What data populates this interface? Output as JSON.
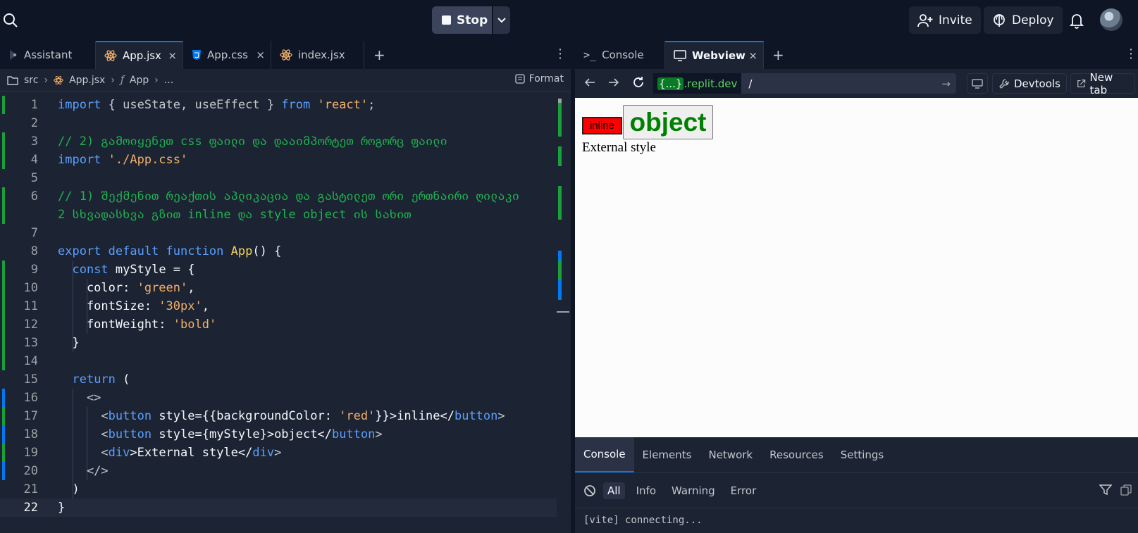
{
  "topbar": {
    "stop_label": "Stop",
    "invite_label": "Invite",
    "deploy_label": "Deploy"
  },
  "editor": {
    "tabs": [
      {
        "label": "Assistant",
        "icon": "assistant-icon"
      },
      {
        "label": "App.jsx",
        "icon": "react-icon",
        "active": true
      },
      {
        "label": "App.css",
        "icon": "css-icon"
      },
      {
        "label": "index.jsx",
        "icon": "react-icon"
      }
    ],
    "close_glyph": "×",
    "plus_glyph": "+",
    "more_glyph": "⋮",
    "breadcrumb": [
      "src",
      "App.jsx",
      "App",
      "..."
    ],
    "format_label": "Format",
    "line_numbers": [
      "1",
      "2",
      "3",
      "4",
      "5",
      "6",
      "",
      "7",
      "8",
      "9",
      "10",
      "11",
      "12",
      "13",
      "14",
      "15",
      "16",
      "17",
      "18",
      "19",
      "20",
      "21",
      "22"
    ],
    "lines": [
      [
        {
          "t": "import",
          "c": "kw"
        },
        {
          "t": " { useState, useEffect } ",
          "c": "pu"
        },
        {
          "t": "from",
          "c": "kw"
        },
        {
          "t": " 'react'",
          "c": "str"
        },
        {
          "t": ";",
          "c": "pu"
        }
      ],
      [],
      [
        {
          "t": "// 2) გამოიყენეთ css ფაილი და დააიმპორტეთ როგორც ფაილი",
          "c": "cm"
        }
      ],
      [
        {
          "t": "import",
          "c": "kw"
        },
        {
          "t": " './App.css'",
          "c": "str"
        }
      ],
      [],
      [
        {
          "t": "// 1) შექმენით რეაქთის აპლიკაცია და გასტილეთ ორი ერთნაირი ღილაკი",
          "c": "cm"
        }
      ],
      [
        {
          "t": "2 სხვადასხვა გზით inline და style object ის სახით",
          "c": "cm"
        }
      ],
      [],
      [
        {
          "t": "export default function",
          "c": "kw"
        },
        {
          "t": " ",
          "c": "pl"
        },
        {
          "t": "App",
          "c": "fn"
        },
        {
          "t": "() {",
          "c": "pl"
        }
      ],
      [
        {
          "t": "  ",
          "c": "pl"
        },
        {
          "t": "const",
          "c": "kw"
        },
        {
          "t": " myStyle = {",
          "c": "pl"
        }
      ],
      [
        {
          "t": "    color: ",
          "c": "pl"
        },
        {
          "t": "'green'",
          "c": "str"
        },
        {
          "t": ",",
          "c": "pl"
        }
      ],
      [
        {
          "t": "    fontSize: ",
          "c": "pl"
        },
        {
          "t": "'30px'",
          "c": "str"
        },
        {
          "t": ",",
          "c": "pl"
        }
      ],
      [
        {
          "t": "    fontWeight: ",
          "c": "pl"
        },
        {
          "t": "'bold'",
          "c": "str"
        }
      ],
      [
        {
          "t": "  }",
          "c": "pl"
        }
      ],
      [],
      [
        {
          "t": "  ",
          "c": "pl"
        },
        {
          "t": "return",
          "c": "kw"
        },
        {
          "t": " (",
          "c": "pl"
        }
      ],
      [
        {
          "t": "    <>",
          "c": "pu"
        }
      ],
      [
        {
          "t": "      <",
          "c": "pu"
        },
        {
          "t": "button",
          "c": "tag"
        },
        {
          "t": " style={{backgroundColor: ",
          "c": "pl"
        },
        {
          "t": "'red'",
          "c": "str"
        },
        {
          "t": "}}>inline</",
          "c": "pl"
        },
        {
          "t": "button",
          "c": "tag"
        },
        {
          "t": ">",
          "c": "pu"
        }
      ],
      [
        {
          "t": "      <",
          "c": "pu"
        },
        {
          "t": "button",
          "c": "tag"
        },
        {
          "t": " style={myStyle}>object</",
          "c": "pl"
        },
        {
          "t": "button",
          "c": "tag"
        },
        {
          "t": ">",
          "c": "pu"
        }
      ],
      [
        {
          "t": "      <",
          "c": "pu"
        },
        {
          "t": "div",
          "c": "tag"
        },
        {
          "t": ">External style</",
          "c": "pl"
        },
        {
          "t": "div",
          "c": "tag"
        },
        {
          "t": ">",
          "c": "pu"
        }
      ],
      [
        {
          "t": "    </>",
          "c": "pu"
        }
      ],
      [
        {
          "t": "  )",
          "c": "pl"
        }
      ],
      [
        {
          "t": "}",
          "c": "pl"
        }
      ]
    ]
  },
  "right": {
    "tabs": [
      {
        "label": "Console",
        "icon": "terminal-icon"
      },
      {
        "label": "Webview",
        "icon": "monitor-icon",
        "active": true
      }
    ],
    "url": {
      "brace": "{...}",
      "host": ".replit.dev",
      "path": "/"
    },
    "devtools_label": "Devtools",
    "newtab_label": "New tab",
    "webview": {
      "inline_button": "inline",
      "object_button": "object",
      "external_text": "External style"
    },
    "devtools_tabs": [
      "Console",
      "Elements",
      "Network",
      "Resources",
      "Settings"
    ],
    "log_filters": [
      "All",
      "Info",
      "Warning",
      "Error"
    ],
    "console_lines": [
      "[vite] connecting..."
    ]
  },
  "colors": {
    "accent": "#0079f2",
    "comment": "#1fb34e",
    "string": "#f2b16a",
    "keyword": "#5aa0ff"
  }
}
